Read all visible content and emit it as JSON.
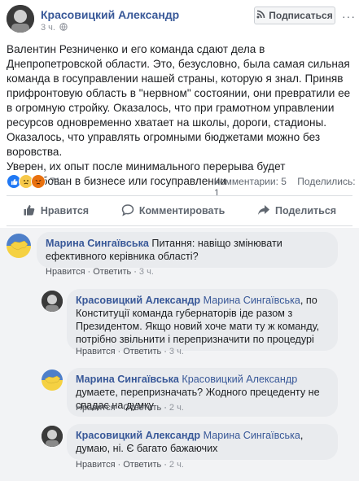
{
  "post": {
    "author": "Красовицкий Александр",
    "time": "3 ч.",
    "follow_label": "Подписаться",
    "more": "···",
    "paragraphs": [
      "Валентин Резниченко и его команда сдают дела в Днепропетровской области. Это, безусловно, была самая сильная команда в госуправлении нашей страны, которую я знал. Приняв прифронтовую область в \"нервном\" состоянии, они превратили ее в огромную стройку. Оказалось, что при грамотном управлении ресурсов одновременно хватает на школы, дороги, стадионы. Оказалось, что управлять огромными бюджетами можно без воровства.",
      "Уверен, их опыт после минимального перерыва будет востребован в бизнесе или госуправлении"
    ],
    "reaction_count": "71",
    "comments_count": "Комментарии: 5",
    "shares_count": "Поделились: 1"
  },
  "actions": {
    "like": "Нравится",
    "comment": "Комментировать",
    "share": "Поделиться"
  },
  "comments": [
    {
      "author": "Марина Сингаївська",
      "mention": "",
      "text": "Питання: навіщо змінювати ефективного керівника області?",
      "like_label": "Нравится",
      "reply_label": "Ответить",
      "time": "3 ч."
    },
    {
      "author": "Красовицкий Александр",
      "mention": "Марина Сингаївська",
      "text": ", по Конституції команда губернаторів іде разом з Президентом. Якщо новий хоче мати ту ж команду, потрібно звільнити і перепризначити по процедурі",
      "like_label": "Нравится",
      "reply_label": "Ответить",
      "time": "3 ч."
    },
    {
      "author": "Марина Сингаївська",
      "mention": "Красовицкий Александр",
      "text": "думаете, перепризначать? Жодного прецеденту не спадає на думку",
      "like_label": "Нравится",
      "reply_label": "Ответить",
      "time": "2 ч."
    },
    {
      "author": "Красовицкий Александр",
      "mention": "Марина Сингаївська",
      "text": ", думаю, ні. Є багато бажаючих",
      "like_label": "Нравится",
      "reply_label": "Ответить",
      "time": "2 ч."
    }
  ],
  "colors": {
    "link": "#385898",
    "like_blue": "#2078f4",
    "comment_bg": "#f2f3f5",
    "bubble_bg": "#e9ebee"
  }
}
